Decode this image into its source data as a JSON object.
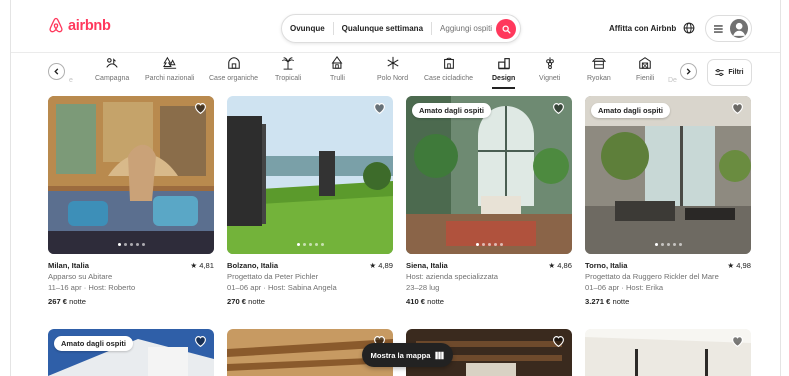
{
  "header": {
    "logo_text": "airbnb",
    "search": {
      "where": "Ovunque",
      "when": "Qualunque settimana",
      "guests": "Aggiungi ospiti"
    },
    "host_link": "Affitta con Airbnb"
  },
  "categories": {
    "partial_left": "e",
    "items": [
      {
        "label": "Campagna",
        "icon": "countryside-icon"
      },
      {
        "label": "Parchi nazionali",
        "icon": "national-park-icon"
      },
      {
        "label": "Case organiche",
        "icon": "organic-house-icon"
      },
      {
        "label": "Tropicali",
        "icon": "tropical-icon"
      },
      {
        "label": "Trulli",
        "icon": "trullo-icon"
      },
      {
        "label": "Polo Nord",
        "icon": "snowflake-icon"
      },
      {
        "label": "Case cicladiche",
        "icon": "cycladic-house-icon"
      },
      {
        "label": "Design",
        "icon": "design-icon",
        "active": true
      },
      {
        "label": "Vigneti",
        "icon": "vineyard-icon"
      },
      {
        "label": "Ryokan",
        "icon": "ryokan-icon"
      },
      {
        "label": "Fienili",
        "icon": "barn-icon"
      }
    ],
    "partial_right": "De",
    "filters_label": "Filtri"
  },
  "listings": [
    {
      "location": "Milan, Italia",
      "rating": "4,81",
      "line2": "Apparso su Abitare",
      "dates_host": "11–16 apr · Host: Roberto",
      "price": "267 €",
      "price_unit": "notte",
      "badge": ""
    },
    {
      "location": "Bolzano, Italia",
      "rating": "4,89",
      "line2": "Progettato da Peter Pichler",
      "dates_host": "01–06 apr · Host: Sabina Angela",
      "price": "270 €",
      "price_unit": "notte",
      "badge": ""
    },
    {
      "location": "Siena, Italia",
      "rating": "4,86",
      "line2": "Host: azienda specializzata",
      "dates_host": "23–28 lug",
      "price": "410 €",
      "price_unit": "notte",
      "badge": "Amato dagli ospiti"
    },
    {
      "location": "Torno, Italia",
      "rating": "4,98",
      "line2": "Progettato da Ruggero Rickler del Mare",
      "dates_host": "01–06 apr · Host: Erika",
      "price": "3.271 €",
      "price_unit": "notte",
      "badge": "Amato dagli ospiti"
    }
  ],
  "second_row": {
    "badge": "Amato dagli ospiti"
  },
  "map_button": "Mostra la mappa",
  "colors": {
    "brand": "#ff385c",
    "text": "#222222",
    "muted": "#717171",
    "border": "#dddddd"
  }
}
